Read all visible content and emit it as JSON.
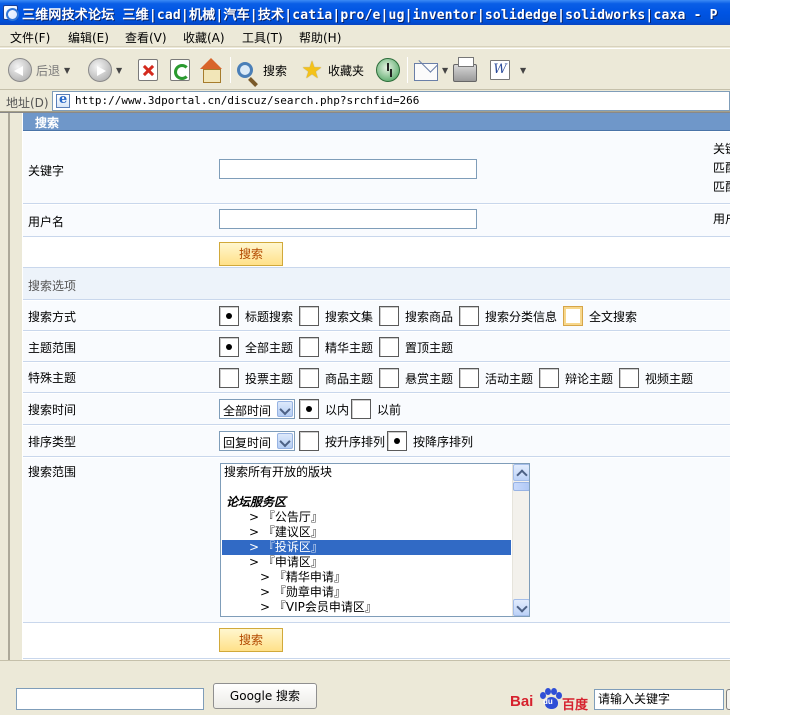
{
  "window": {
    "title": "三维网技术论坛 三维|cad|机械|汽车|技术|catia|pro/e|ug|inventor|solidedge|solidworks|caxa - P"
  },
  "menu": [
    "文件(F)",
    "编辑(E)",
    "查看(V)",
    "收藏(A)",
    "工具(T)",
    "帮助(H)"
  ],
  "toolbar": {
    "back_label": "后退",
    "search_label": "搜索",
    "favorites_label": "收藏夹"
  },
  "address": {
    "label": "地址(D)",
    "url": "http://www.3dportal.cn/discuz/search.php?srchfid=266"
  },
  "search_form": {
    "header": "搜索",
    "keyword_label": "关键字",
    "keyword_value": "",
    "keyword_hint": [
      "关键",
      "匹配",
      "匹配"
    ],
    "username_label": "用户名",
    "username_value": "",
    "username_hint": "用户",
    "search_button": "搜索",
    "options_header": "搜索选项",
    "method": {
      "label": "搜索方式",
      "options": [
        "标题搜索",
        "搜索文集",
        "搜索商品",
        "搜索分类信息",
        "全文搜索"
      ],
      "selected": 0
    },
    "scope": {
      "label": "主题范围",
      "options": [
        "全部主题",
        "精华主题",
        "置顶主题"
      ],
      "selected": 0
    },
    "special": {
      "label": "特殊主题",
      "options": [
        "投票主题",
        "商品主题",
        "悬赏主题",
        "活动主题",
        "辩论主题",
        "视频主题"
      ]
    },
    "time": {
      "label": "搜索时间",
      "select_value": "全部时间",
      "options": [
        "以内",
        "以前"
      ],
      "selected": 0
    },
    "order": {
      "label": "排序类型",
      "select_value": "回复时间",
      "options": [
        "按升序排列",
        "按降序排列"
      ],
      "selected": 1
    },
    "forums": {
      "label": "搜索范围",
      "items": [
        {
          "text": "搜索所有开放的版块",
          "type": "plain"
        },
        {
          "text": "",
          "type": "blank"
        },
        {
          "text": "论坛服务区",
          "type": "group"
        },
        {
          "text": "> 『公告厅』",
          "type": "sub"
        },
        {
          "text": "> 『建议区』",
          "type": "sub"
        },
        {
          "text": "> 『投诉区』",
          "type": "sub",
          "selected": true
        },
        {
          "text": "> 『申请区』",
          "type": "sub"
        },
        {
          "text": "> 『精华申请』",
          "type": "subsub"
        },
        {
          "text": "> 『勋章申请』",
          "type": "subsub"
        },
        {
          "text": "> 『VIP会员申请区』",
          "type": "subsub"
        }
      ]
    },
    "submit_button": "搜索"
  },
  "bottom": {
    "google_button": "Google 搜索",
    "baidu_logo_bai": "Bai",
    "baidu_logo_du": "du",
    "baidu_logo_cn": "百度",
    "baidu_placeholder": "请输入关键字"
  }
}
